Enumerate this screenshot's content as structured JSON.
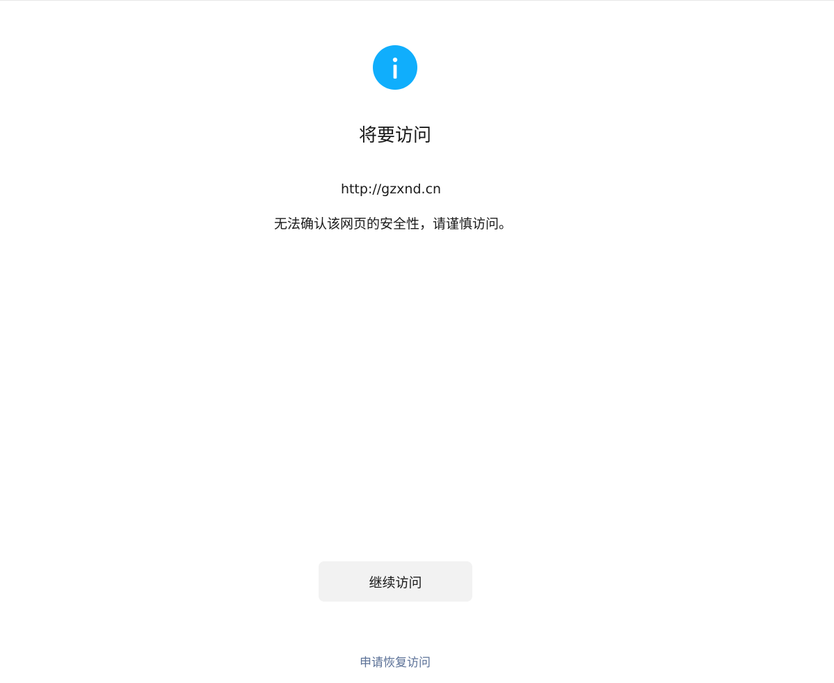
{
  "page": {
    "icon": "info-icon",
    "title": "将要访问",
    "url": "http://gzxnd.cn",
    "warning": "无法确认该网页的安全性，请谨慎访问。"
  },
  "actions": {
    "continue_label": "继续访问",
    "appeal_label": "申请恢复访问"
  },
  "colors": {
    "accent": "#10aefc",
    "link": "#5b7197",
    "button_bg": "#f2f2f2"
  }
}
